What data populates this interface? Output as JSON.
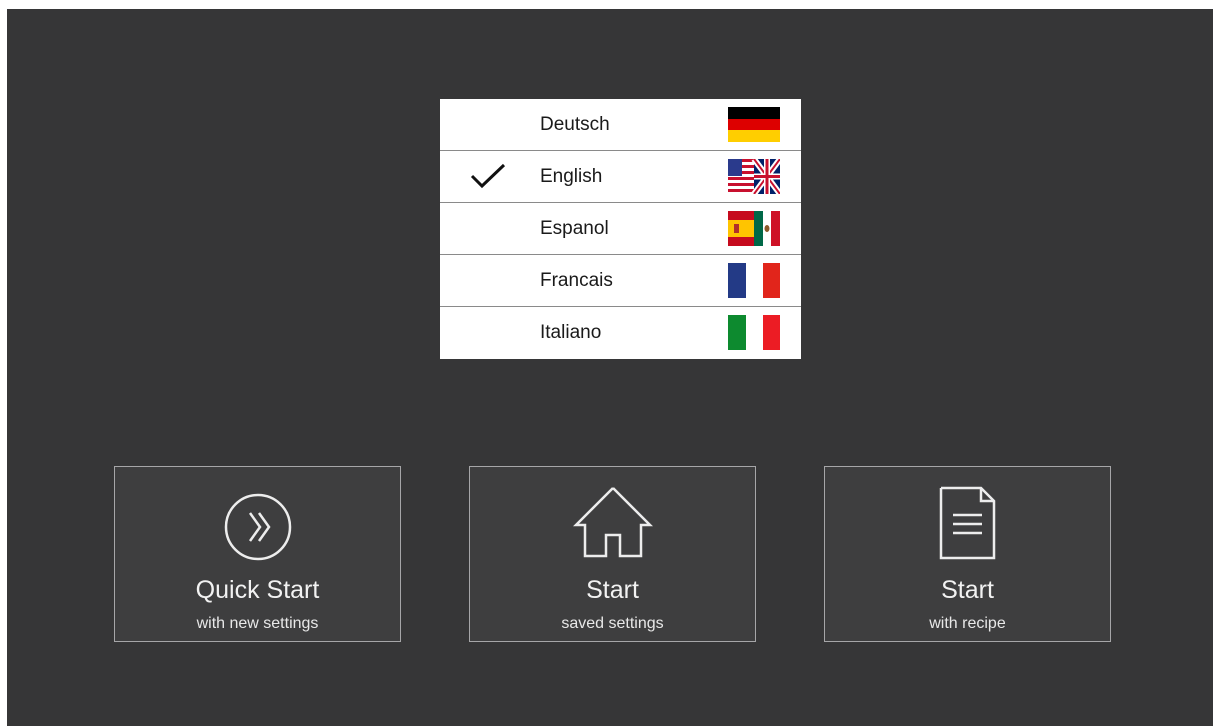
{
  "languages": [
    {
      "label": "Deutsch",
      "selected": false,
      "flag": "germany-flag"
    },
    {
      "label": "English",
      "selected": true,
      "flag": "usa-uk-flag"
    },
    {
      "label": "Espanol",
      "selected": false,
      "flag": "spain-mexico-flag"
    },
    {
      "label": "Francais",
      "selected": false,
      "flag": "france-flag"
    },
    {
      "label": "Italiano",
      "selected": false,
      "flag": "italy-flag"
    }
  ],
  "tiles": [
    {
      "title": "Quick Start",
      "subtitle": "with new settings",
      "icon": "double-chevron-circle-icon"
    },
    {
      "title": "Start",
      "subtitle": "saved settings",
      "icon": "house-icon"
    },
    {
      "title": "Start",
      "subtitle": "with recipe",
      "icon": "document-icon"
    }
  ],
  "colors": {
    "screen_background": "#363637",
    "tile_background": "#3e3e3f",
    "tile_border": "#a6a6a8",
    "list_background": "#ffffff"
  }
}
